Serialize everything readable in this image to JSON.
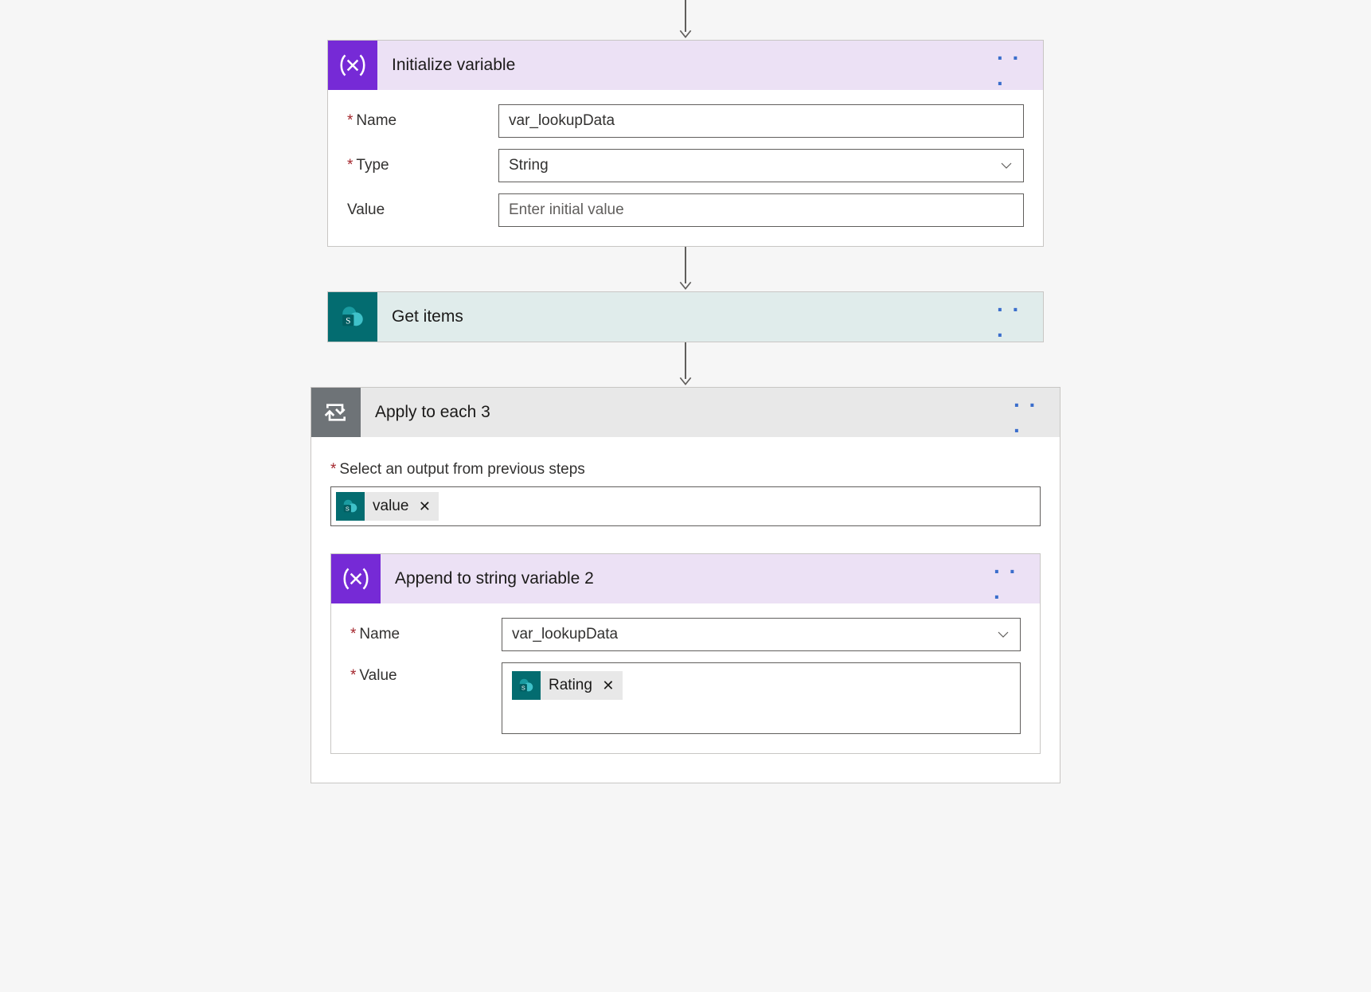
{
  "init_var": {
    "title": "Initialize variable",
    "name_label": "Name",
    "type_label": "Type",
    "value_label": "Value",
    "name_value": "var_lookupData",
    "type_value": "String",
    "value_placeholder": "Enter initial value"
  },
  "get_items": {
    "title": "Get items"
  },
  "loop": {
    "title": "Apply to each 3",
    "select_label": "Select an output from previous steps",
    "token_label": "value"
  },
  "append": {
    "title": "Append to string variable 2",
    "name_label": "Name",
    "value_label": "Value",
    "name_value": "var_lookupData",
    "token_label": "Rating"
  },
  "menu_dots": ". . ."
}
